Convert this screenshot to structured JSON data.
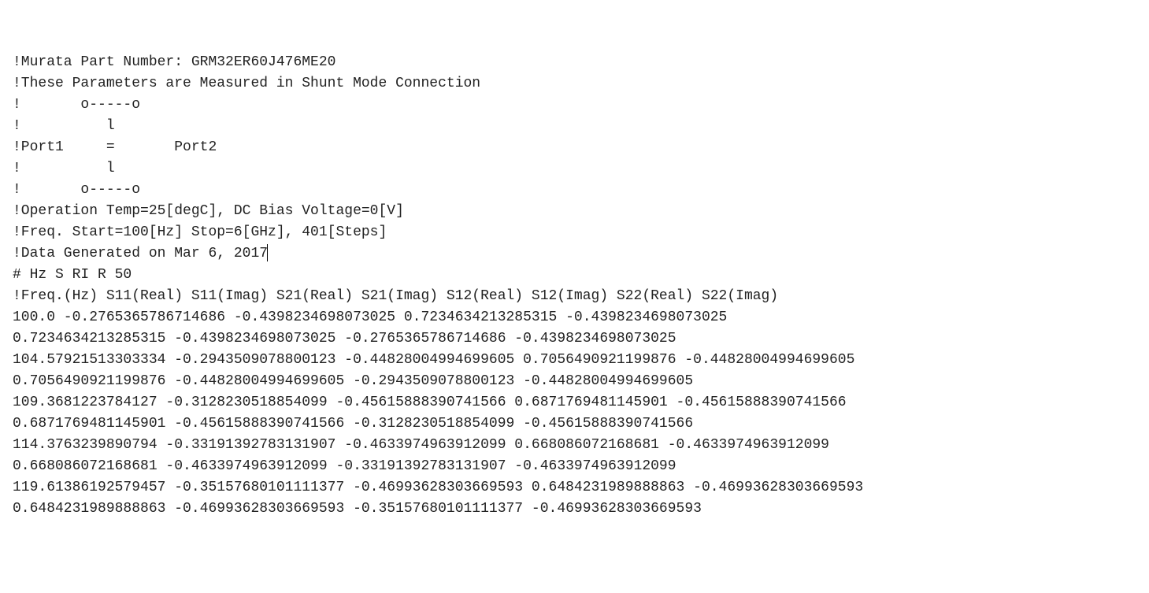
{
  "header": {
    "part_line": "!Murata Part Number: GRM32ER60J476ME20",
    "measured_line": "!These Parameters are Measured in Shunt Mode Connection",
    "ascii1": "!       o-----o",
    "ascii2": "!          l",
    "ascii3": "!Port1     =       Port2",
    "ascii4": "!          l",
    "ascii5": "!       o-----o",
    "operation_line": "!Operation Temp=25[degC], DC Bias Voltage=0[V]",
    "freq_line": "!Freq. Start=100[Hz] Stop=6[GHz], 401[Steps]",
    "data_generated_line": "!Data Generated on Mar 6, 2017",
    "option_line": "# Hz S RI R 50",
    "column_header_line": "!Freq.(Hz) S11(Real) S11(Imag) S21(Real) S21(Imag) S12(Real) S12(Imag) S22(Real) S22(Imag)"
  },
  "data_lines": {
    "l1": "100.0 -0.2765365786714686 -0.4398234698073025 0.7234634213285315 -0.4398234698073025",
    "l2": "0.7234634213285315 -0.4398234698073025 -0.2765365786714686 -0.4398234698073025",
    "l3": "104.57921513303334 -0.2943509078800123 -0.44828004994699605 0.7056490921199876 -0.44828004994699605",
    "l4": "0.7056490921199876 -0.44828004994699605 -0.2943509078800123 -0.44828004994699605",
    "l5": "109.3681223784127 -0.3128230518854099 -0.45615888390741566 0.6871769481145901 -0.45615888390741566",
    "l6": "0.6871769481145901 -0.45615888390741566 -0.3128230518854099 -0.45615888390741566",
    "l7": "114.3763239890794 -0.33191392783131907 -0.4633974963912099 0.668086072168681 -0.4633974963912099",
    "l8": "0.668086072168681 -0.4633974963912099 -0.33191392783131907 -0.4633974963912099",
    "l9": "119.61386192579457 -0.35157680101111377 -0.46993628303669593 0.6484231989888863 -0.46993628303669593",
    "l10": "0.6484231989888863 -0.46993628303669593 -0.35157680101111377 -0.46993628303669593"
  }
}
